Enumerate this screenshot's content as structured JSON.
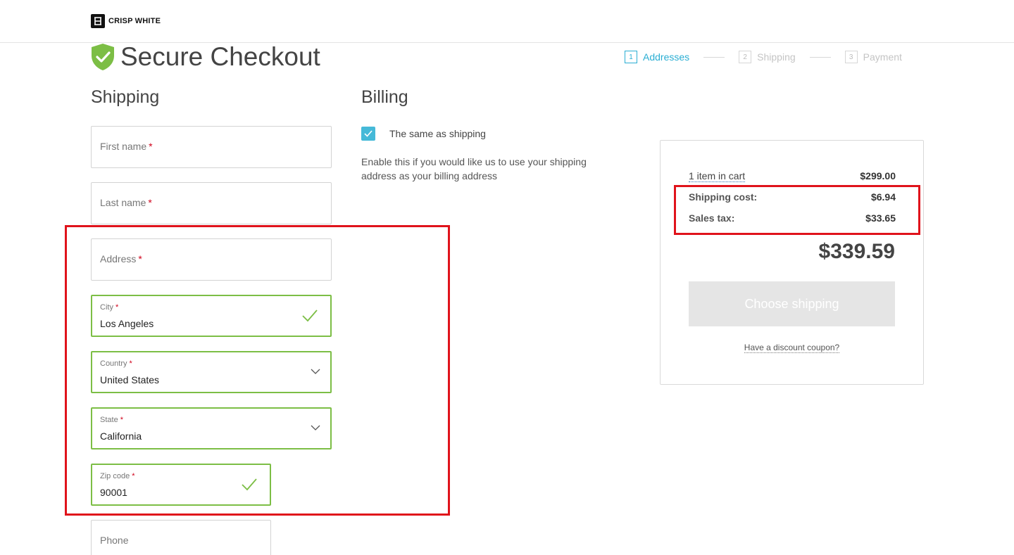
{
  "brand": {
    "name": "CRISP WHITE"
  },
  "header": {
    "title": "Secure Checkout"
  },
  "steps": [
    {
      "num": "1",
      "label": "Addresses",
      "active": true
    },
    {
      "num": "2",
      "label": "Shipping",
      "active": false
    },
    {
      "num": "3",
      "label": "Payment",
      "active": false
    }
  ],
  "shipping": {
    "title": "Shipping",
    "first_name": {
      "placeholder": "First name",
      "required": "*"
    },
    "last_name": {
      "placeholder": "Last name",
      "required": "*"
    },
    "address": {
      "placeholder": "Address",
      "required": "*"
    },
    "city": {
      "label": "City",
      "required": "*",
      "value": "Los Angeles"
    },
    "country": {
      "label": "Country",
      "required": "*",
      "value": "United States"
    },
    "state": {
      "label": "State",
      "required": "*",
      "value": "California"
    },
    "zip": {
      "label": "Zip code",
      "required": "*",
      "value": "90001"
    },
    "phone": {
      "placeholder": "Phone"
    }
  },
  "billing": {
    "title": "Billing",
    "same_as_shipping_label": "The same as shipping",
    "same_as_shipping_checked": true,
    "help_text": "Enable this if you would like us to use your shipping address as your billing address"
  },
  "summary": {
    "cart_link": "1 item in cart",
    "cart_amount": "$299.00",
    "shipping_label": "Shipping cost:",
    "shipping_amount": "$6.94",
    "tax_label": "Sales tax:",
    "tax_amount": "$33.65",
    "total": "$339.59",
    "choose_shipping_label": "Choose shipping",
    "coupon_link": "Have a discount coupon?"
  },
  "colors": {
    "accent": "#2aaed3",
    "valid_border": "#7cbe45",
    "required": "#d0021b",
    "highlight": "#e0131b",
    "link": "#2d6fb0"
  }
}
